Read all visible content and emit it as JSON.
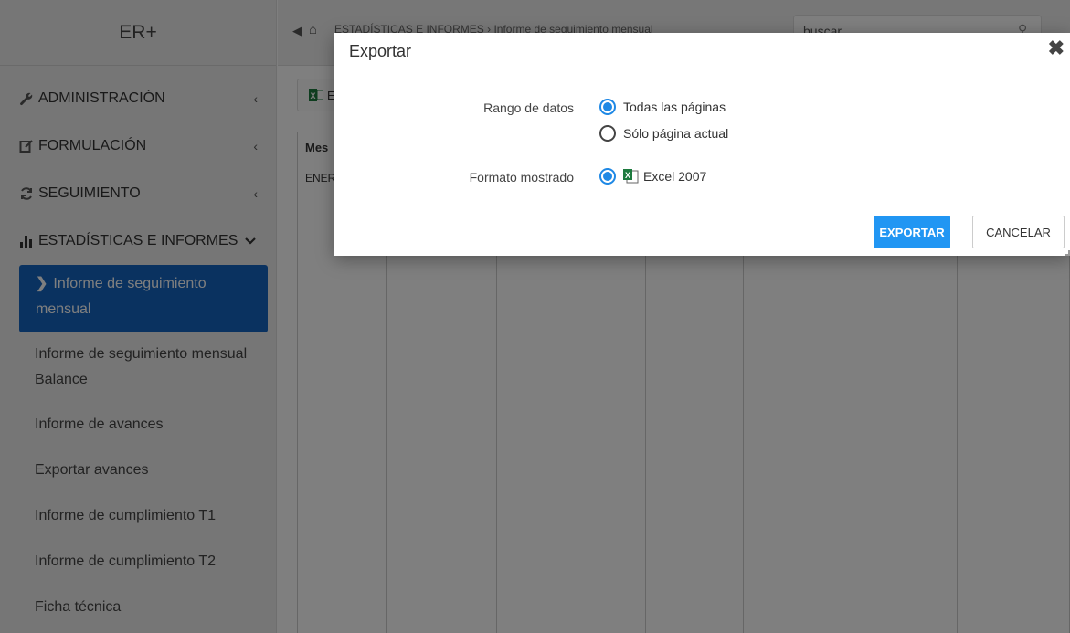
{
  "sidebar": {
    "brand": "ER+",
    "menu": [
      {
        "label": "ADMINISTRACIÓN",
        "icon": "wrench-icon"
      },
      {
        "label": "FORMULACIÓN",
        "icon": "edit-icon"
      },
      {
        "label": "SEGUIMIENTO",
        "icon": "refresh-icon"
      }
    ],
    "open_menu": {
      "label": "ESTADÍSTICAS E INFORMES",
      "icon": "bar-chart-icon"
    },
    "submenu": [
      {
        "label": "Informe de seguimiento mensual",
        "active": true
      },
      {
        "label": "Informe de seguimiento mensual Balance"
      },
      {
        "label": "Informe de avances"
      },
      {
        "label": "Exportar avances"
      },
      {
        "label": "Informe de cumplimiento T1"
      },
      {
        "label": "Informe de cumplimiento T2"
      },
      {
        "label": "Ficha técnica"
      }
    ]
  },
  "topbar": {
    "breadcrumb": "ESTADÍSTICAS E INFORMES  ›  Informe de seguimiento mensual",
    "search_value": "buscar"
  },
  "content": {
    "export_button_label": "E",
    "grid": {
      "first_header": "Mes",
      "first_cell": "ENER"
    }
  },
  "dialog": {
    "title": "Exportar",
    "range_label": "Rango de datos",
    "range_options": [
      "Todas las páginas",
      "Sólo página actual"
    ],
    "range_selected": 0,
    "format_label": "Formato mostrado",
    "format_option": "Excel 2007",
    "export_button": "EXPORTAR",
    "cancel_button": "CANCELAR"
  },
  "colors": {
    "accent": "#2196f3",
    "active_menu": "#1565c0",
    "overlay": "rgba(0,0,0,0.5)"
  }
}
